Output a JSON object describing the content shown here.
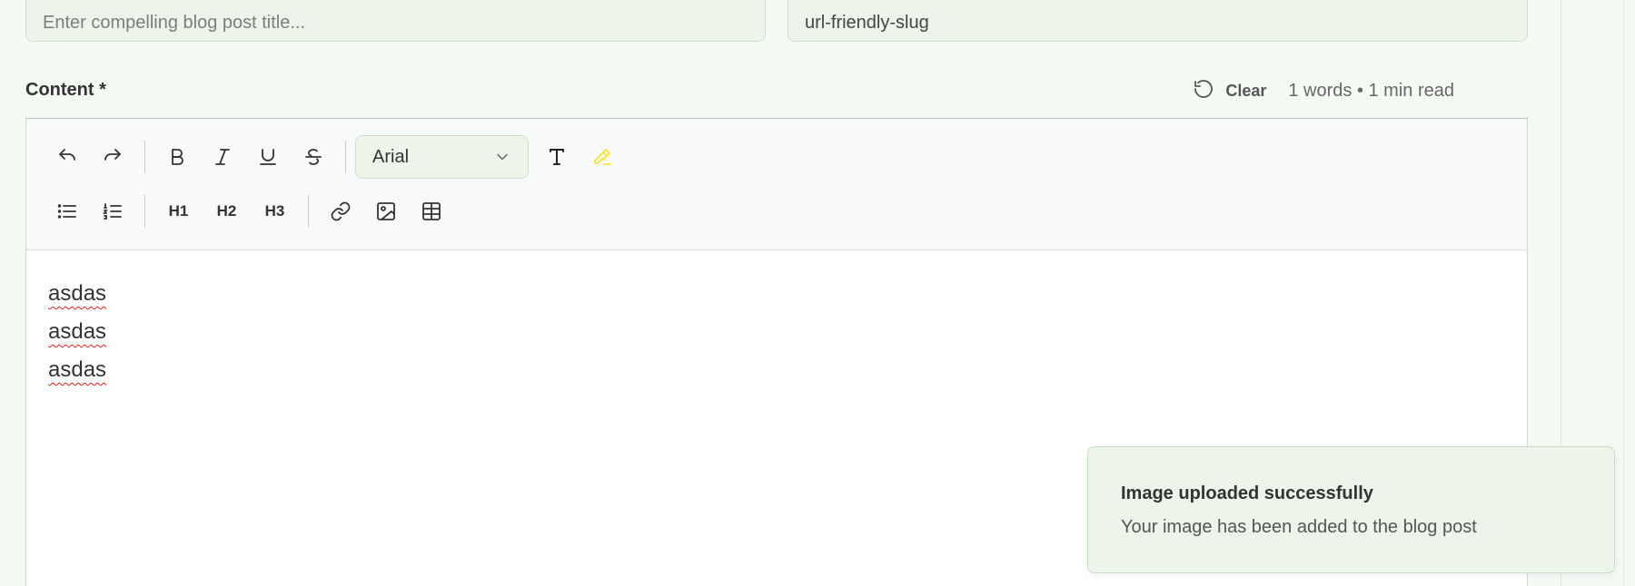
{
  "form": {
    "title_placeholder": "Enter compelling blog post title...",
    "slug_value": "url-friendly-slug"
  },
  "content": {
    "label": "Content *",
    "clear_label": "Clear",
    "word_count": "1 words • 1 min read"
  },
  "toolbar": {
    "font_family": "Arial",
    "h1": "H1",
    "h2": "H2",
    "h3": "H3",
    "highlight_color": "#f5e72c"
  },
  "editor": {
    "lines": [
      "asdas",
      "asdas",
      "asdas"
    ]
  },
  "toast": {
    "title": "Image uploaded successfully",
    "description": "Your image has been added to the blog post"
  },
  "colors": {
    "field_bg": "#edf5ea",
    "field_border": "#cfe0ca",
    "page_bg": "#f6faf5"
  }
}
